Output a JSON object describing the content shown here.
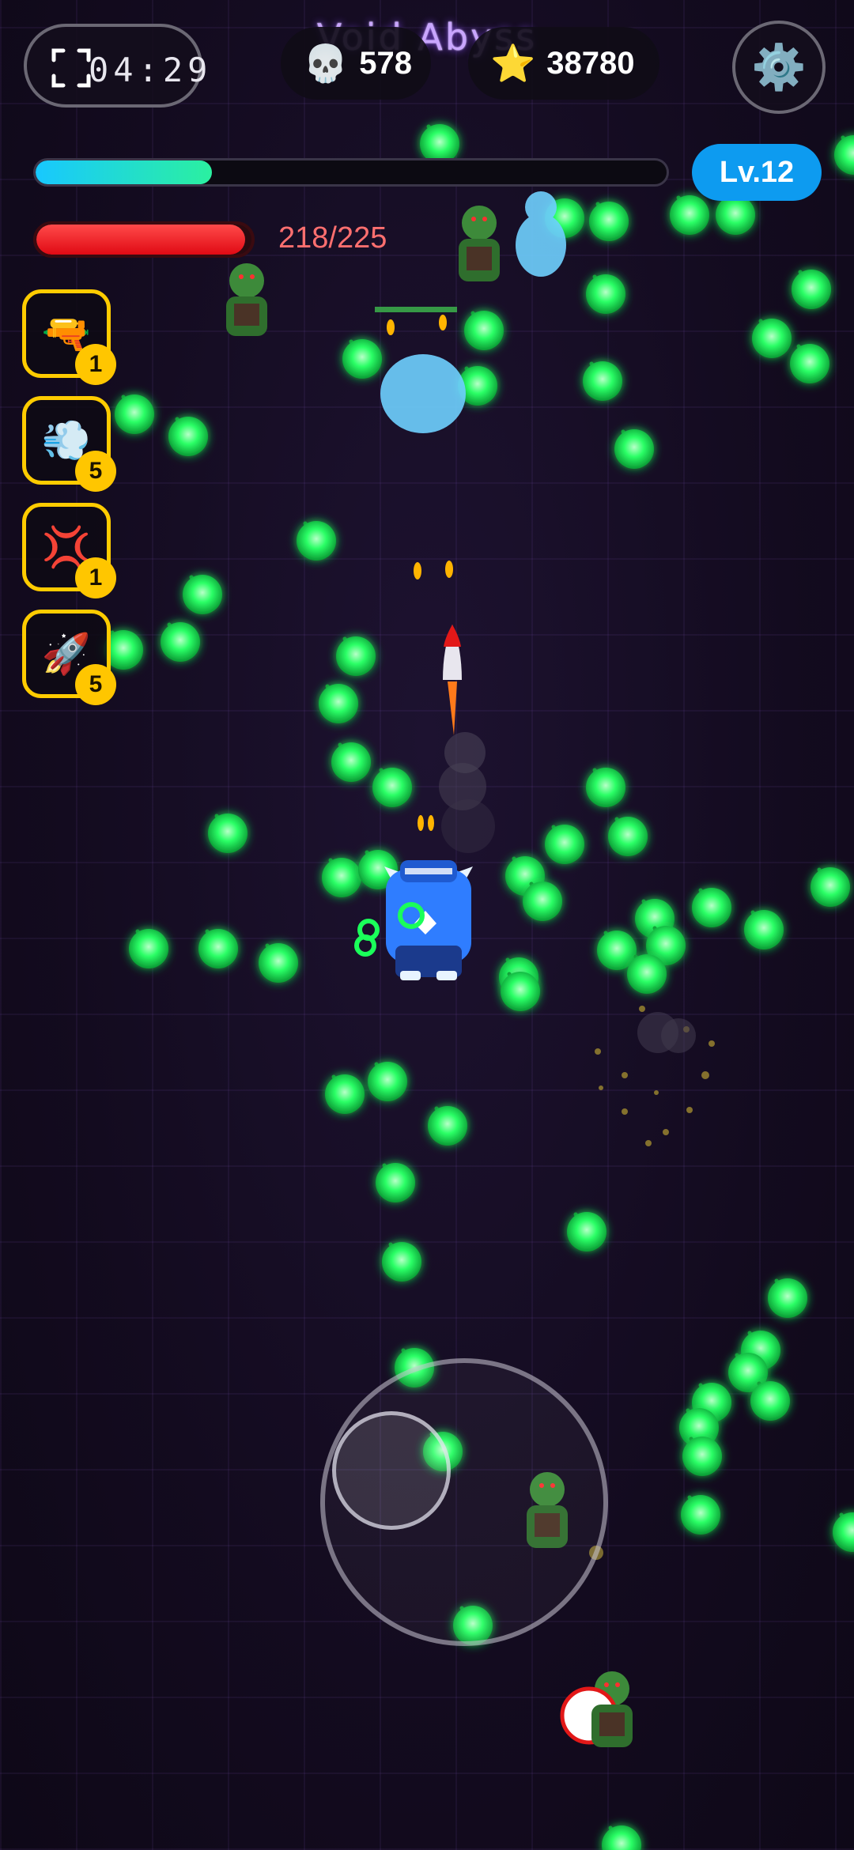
{
  "hud": {
    "title": "Void Abyss",
    "timer": "04:29",
    "kills": "578",
    "score": "38780",
    "level": "Lv.12",
    "xp_fraction": 0.28,
    "hp_text": "218/225",
    "hp_current": 218,
    "hp_max": 225,
    "icons": {
      "timer": "screenshot-frame-icon",
      "kills": "skull-icon",
      "score": "star-icon",
      "settings": "gear-icon"
    }
  },
  "weapons": [
    {
      "name": "pistol",
      "icon": "pistol-icon",
      "glyph": "🔫",
      "level": "1"
    },
    {
      "name": "dash",
      "icon": "wind-dash-icon",
      "glyph": "💨",
      "level": "5"
    },
    {
      "name": "rage",
      "icon": "anger-icon",
      "glyph": "💢",
      "level": "1"
    },
    {
      "name": "rocket",
      "icon": "rocket-icon",
      "glyph": "🚀",
      "level": "5"
    }
  ],
  "colors": {
    "xp_start": "#18c8ff",
    "xp_end": "#2bf0a0",
    "hp": "#ff2a2a",
    "level_badge": "#0d9bf0",
    "slot_border": "#ffcc00",
    "orb": "#1aff5a",
    "ghost": "#6fd0ff"
  }
}
